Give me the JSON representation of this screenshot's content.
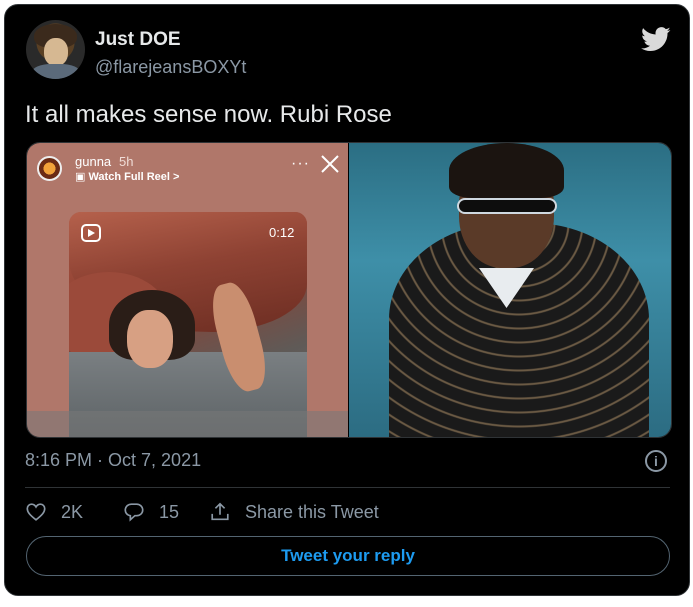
{
  "tweet": {
    "display_name": "Just DOE",
    "handle": "@flarejeansBOXYt",
    "text": "It all makes sense now. Rubi Rose",
    "timestamp": "8:16 PM · Oct 7, 2021",
    "info_icon": "i"
  },
  "story": {
    "username": "gunna",
    "time": "5h",
    "link": "Watch Full Reel >",
    "more": "···",
    "reel_duration": "0:12"
  },
  "actions": {
    "likes": "2K",
    "replies": "15",
    "share_label": "Share this Tweet"
  },
  "reply_button": "Tweet your reply",
  "icons": {
    "brand": "twitter-bird-icon",
    "like": "heart-icon",
    "reply": "speech-bubble-icon",
    "share": "share-upload-icon",
    "info": "info-icon"
  },
  "colors": {
    "background": "#000000",
    "text_primary": "#e7e9ea",
    "text_secondary": "#8b98a5",
    "accent": "#1d9bf0",
    "border": "#2f3336"
  }
}
